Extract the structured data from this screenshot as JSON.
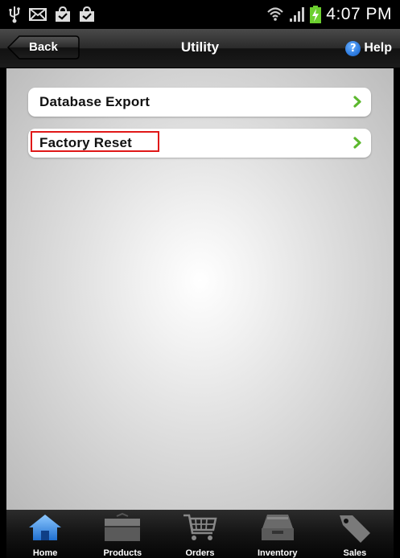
{
  "status_bar": {
    "icons_left": [
      "usb-icon",
      "mail-icon",
      "shopping-bag-icon",
      "shopping-bag-icon"
    ],
    "icons_right": [
      "wifi-icon",
      "signal-icon",
      "battery-charging-icon"
    ],
    "time": "4:07 PM"
  },
  "nav": {
    "back_label": "Back",
    "title": "Utility",
    "help_icon_glyph": "?",
    "help_label": "Help"
  },
  "menu": {
    "items": [
      {
        "label": "Database Export",
        "icon": "chevron-right-icon"
      },
      {
        "label": "Factory Reset",
        "icon": "chevron-right-icon",
        "highlighted": true
      }
    ]
  },
  "tabs": [
    {
      "label": "Home",
      "icon": "home-icon",
      "selected": true
    },
    {
      "label": "Products",
      "icon": "box-icon",
      "selected": false
    },
    {
      "label": "Orders",
      "icon": "shopping-cart-icon",
      "selected": false
    },
    {
      "label": "Inventory",
      "icon": "file-tray-icon",
      "selected": false
    },
    {
      "label": "Sales",
      "icon": "price-tag-icon",
      "selected": false
    }
  ],
  "colors": {
    "accent_green": "#5cb82e",
    "help_blue": "#2f7de1",
    "highlight_red": "#e01818",
    "selected_tab_blue": "#3a8fe6"
  }
}
